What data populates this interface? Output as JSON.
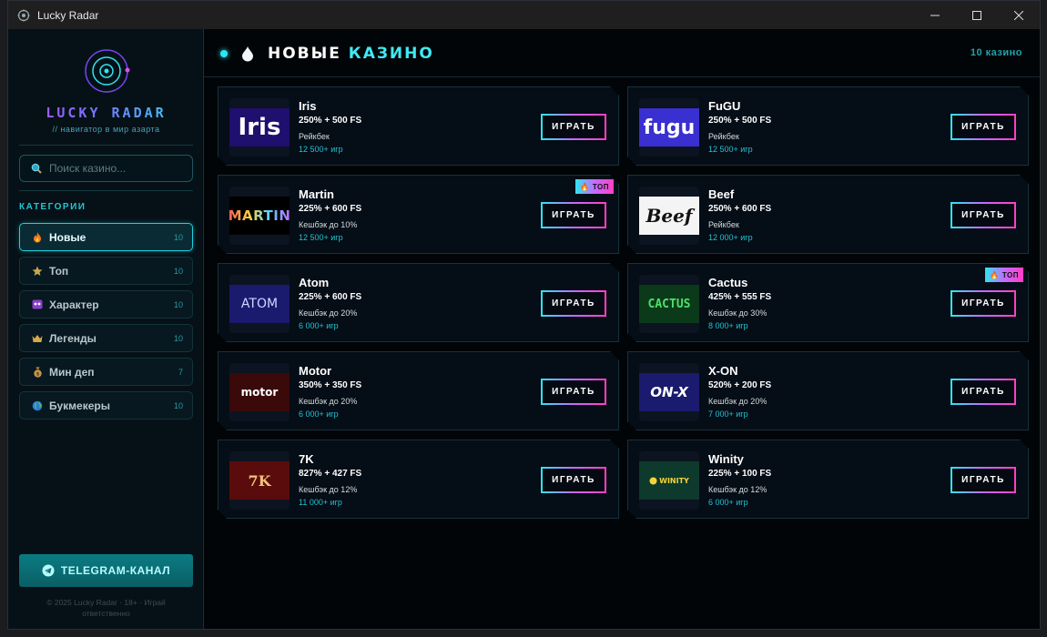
{
  "window": {
    "title": "Lucky Radar"
  },
  "sidebar": {
    "brand": "LUCKY RADAR",
    "tagline": "// навигатор в мир азарта",
    "search": {
      "placeholder": "Поиск казино..."
    },
    "categories_title": "КАТЕГОРИИ",
    "categories": [
      {
        "label": "Новые",
        "count": "10",
        "icon": "fire-icon",
        "active": true
      },
      {
        "label": "Топ",
        "count": "10",
        "icon": "star-icon"
      },
      {
        "label": "Характер",
        "count": "10",
        "icon": "mask-icon"
      },
      {
        "label": "Легенды",
        "count": "10",
        "icon": "crown-icon"
      },
      {
        "label": "Мин деп",
        "count": "7",
        "icon": "money-bag-icon"
      },
      {
        "label": "Букмекеры",
        "count": "10",
        "icon": "globe-icon"
      }
    ],
    "telegram_label": "TELEGRAM-КАНАЛ",
    "footer": "© 2025 Lucky Radar · 18+ · Играй ответственно"
  },
  "header": {
    "title_part1": "НОВЫЕ",
    "title_part2": "КАЗИНО",
    "count": "10 казино"
  },
  "play_label": "ИГРАТЬ",
  "top_badge": "ТОП",
  "casinos": [
    {
      "name": "Iris",
      "bonus": "250% + 500 FS",
      "cashback": "Рейкбек",
      "games": "12 500+ игр",
      "logo_text": "Iris",
      "top": false
    },
    {
      "name": "FuGU",
      "bonus": "250% + 500 FS",
      "cashback": "Рейкбек",
      "games": "12 500+ игр",
      "logo_text": "fugu",
      "top": false
    },
    {
      "name": "Martin",
      "bonus": "225% + 600 FS",
      "cashback": "Кешбэк до 10%",
      "games": "12 500+ игр",
      "logo_text": "MARTIN",
      "top": true
    },
    {
      "name": "Beef",
      "bonus": "250% + 600 FS",
      "cashback": "Рейкбек",
      "games": "12 000+ игр",
      "logo_text": "Beef",
      "top": false
    },
    {
      "name": "Atom",
      "bonus": "225% + 600 FS",
      "cashback": "Кешбэк до 20%",
      "games": "6 000+ игр",
      "logo_text": "ATOM",
      "top": false
    },
    {
      "name": "Cactus",
      "bonus": "425% + 555 FS",
      "cashback": "Кешбэк до 30%",
      "games": "8 000+ игр",
      "logo_text": "CACTUS",
      "top": true
    },
    {
      "name": "Motor",
      "bonus": "350% + 350 FS",
      "cashback": "Кешбэк до 20%",
      "games": "6 000+ игр",
      "logo_text": "motor",
      "top": false
    },
    {
      "name": "X-ON",
      "bonus": "520% + 200 FS",
      "cashback": "Кешбэк до 20%",
      "games": "7 000+ игр",
      "logo_text": "ON-X",
      "top": false
    },
    {
      "name": "7K",
      "bonus": "827% + 427 FS",
      "cashback": "Кешбэк до 12%",
      "games": "11 000+ игр",
      "logo_text": "7K",
      "top": false
    },
    {
      "name": "Winity",
      "bonus": "225% + 100 FS",
      "cashback": "Кешбэк до 12%",
      "games": "6 000+ игр",
      "logo_text": "WINITY",
      "top": false
    }
  ]
}
